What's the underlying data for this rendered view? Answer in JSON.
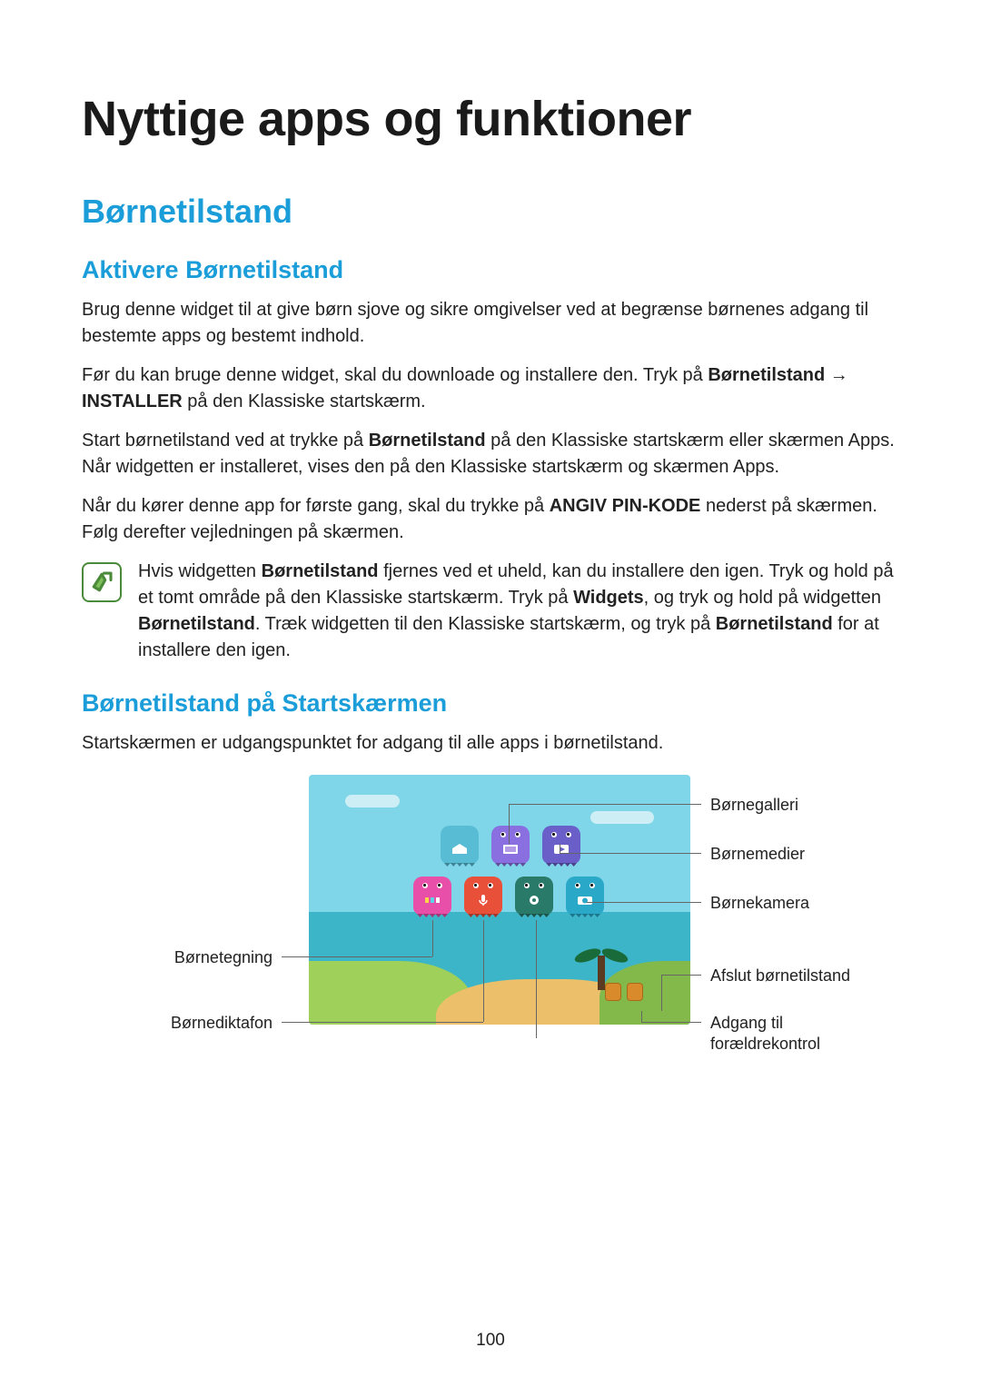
{
  "page_title": "Nyttige apps og funktioner",
  "section_title": "Børnetilstand",
  "aktivere": {
    "heading": "Aktivere Børnetilstand",
    "p1": "Brug denne widget til at give børn sjove og sikre omgivelser ved at begrænse børnenes adgang til bestemte apps og bestemt indhold.",
    "p2_a": "Før du kan bruge denne widget, skal du downloade og installere den. Tryk på ",
    "p2_b1": "Børnetilstand",
    "p2_arrow": " → ",
    "p2_b2": "INSTALLER",
    "p2_c": " på den Klassiske startskærm.",
    "p3_a": "Start børnetilstand ved at trykke på ",
    "p3_b": "Børnetilstand",
    "p3_c": " på den Klassiske startskærm eller skærmen Apps. Når widgetten er installeret, vises den på den Klassiske startskærm og skærmen Apps.",
    "p4_a": "Når du kører denne app for første gang, skal du trykke på ",
    "p4_b": "ANGIV PIN-KODE",
    "p4_c": " nederst på skærmen. Følg derefter vejledningen på skærmen.",
    "note_a": "Hvis widgetten ",
    "note_b1": "Børnetilstand",
    "note_c": " fjernes ved et uheld, kan du installere den igen. Tryk og hold på et tomt område på den Klassiske startskærm. Tryk på ",
    "note_b2": "Widgets",
    "note_d": ", og tryk og hold på widgetten ",
    "note_b3": "Børnetilstand",
    "note_e": ". Træk widgetten til den Klassiske startskærm, og tryk på ",
    "note_b4": "Børnetilstand",
    "note_f": " for at installere den igen."
  },
  "startskaerm": {
    "heading": "Børnetilstand på Startskærmen",
    "intro": "Startskærmen er udgangspunktet for adgang til alle apps i børnetilstand."
  },
  "callouts": {
    "gallery": "Børnegalleri",
    "media": "Børnemedier",
    "camera": "Børnekamera",
    "exit": "Afslut børnetilstand",
    "parental": "Adgang til\nforældrekontrol",
    "drawing": "Børnetegning",
    "voice": "Børnediktafon"
  },
  "page_number": "100"
}
